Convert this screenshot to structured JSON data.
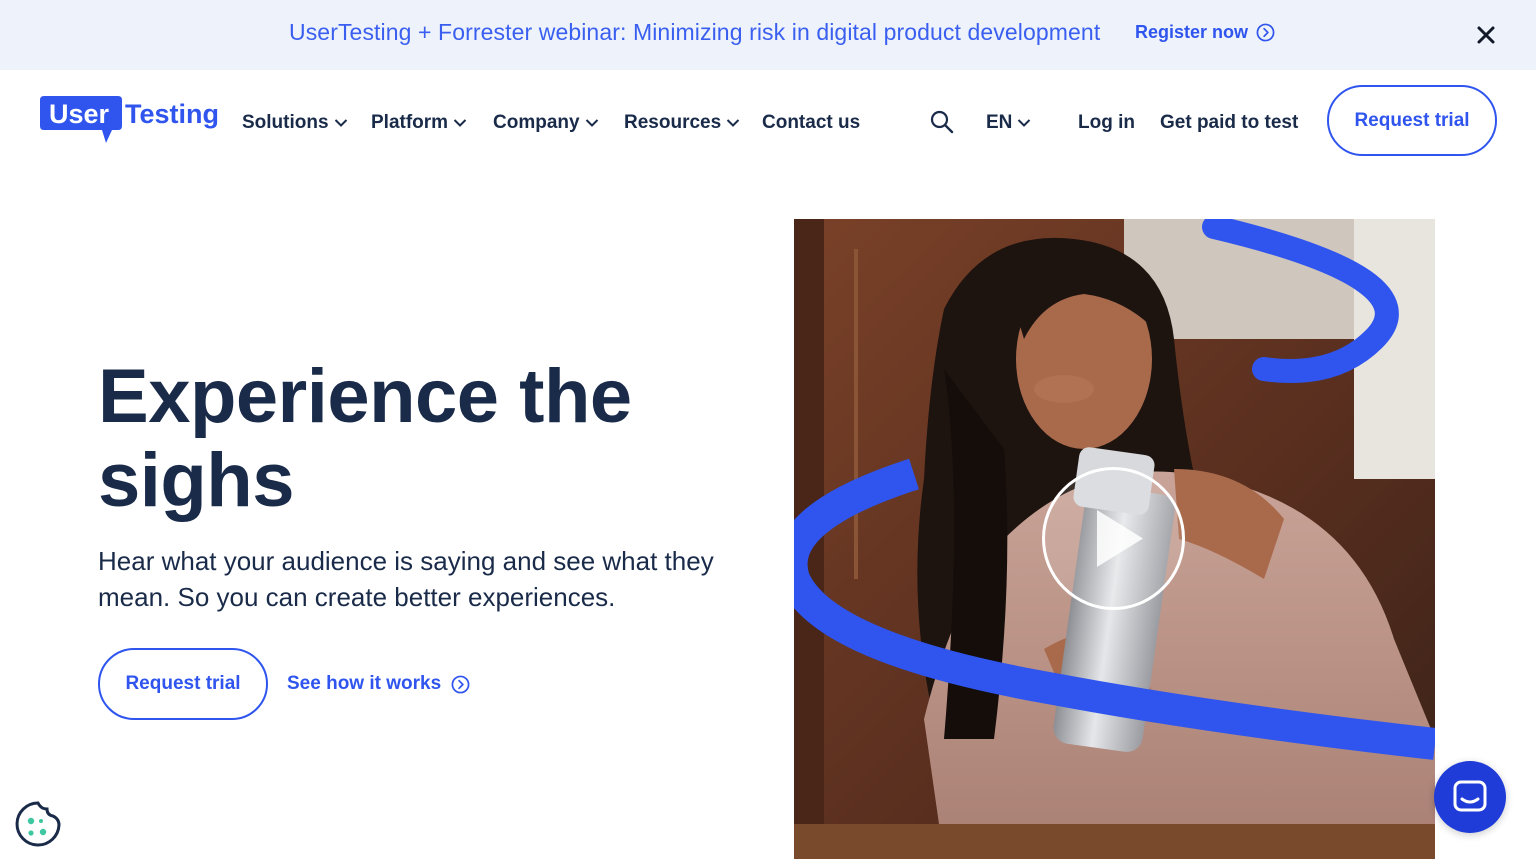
{
  "banner": {
    "text": "UserTesting + Forrester webinar: Minimizing risk in digital product development",
    "link_label": "Register now",
    "close_icon": "close-icon"
  },
  "logo": {
    "part1": "User",
    "part2": "Testing"
  },
  "nav": {
    "items": [
      {
        "label": "Solutions",
        "has_dropdown": true
      },
      {
        "label": "Platform",
        "has_dropdown": true
      },
      {
        "label": "Company",
        "has_dropdown": true
      },
      {
        "label": "Resources",
        "has_dropdown": true
      },
      {
        "label": "Contact us",
        "has_dropdown": false
      }
    ],
    "search_icon": "search-icon",
    "language": "EN",
    "login_label": "Log in",
    "get_paid_label": "Get paid to test",
    "request_trial_label": "Request trial"
  },
  "hero": {
    "title": "Experience the sighs",
    "subtitle": "Hear what your audience is saying and see what they mean. So you can create better experiences.",
    "primary_cta": "Request trial",
    "secondary_cta": "See how it works"
  },
  "media": {
    "play_icon": "play-icon"
  },
  "widgets": {
    "chat_icon": "chat-icon",
    "cookie_icon": "cookie-icon"
  },
  "colors": {
    "brand_blue": "#2f55ee",
    "navy_text": "#1a2b4a",
    "banner_bg": "#eef3fb",
    "chat_bg": "#1f3cd9"
  }
}
